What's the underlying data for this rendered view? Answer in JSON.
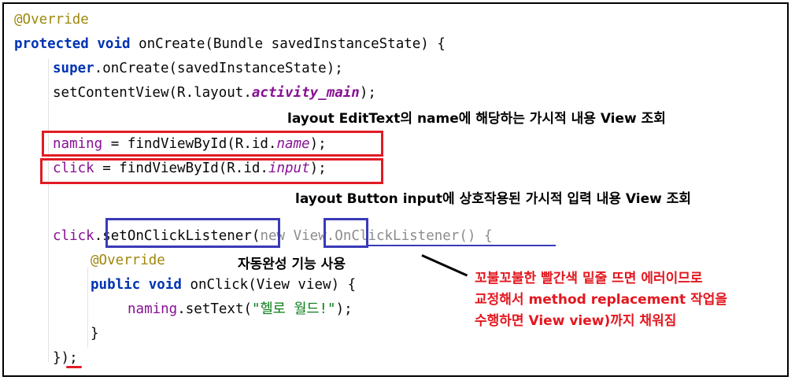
{
  "code": {
    "line1_annotation": "@Override",
    "line2_protected": "protected",
    "line2_void": "void",
    "line2_rest": "onCreate(Bundle savedInstanceState) {",
    "line3_super": "super",
    "line3_rest": ".onCreate(savedInstanceState);",
    "line4_pre": "setContentView(R.layout.",
    "line4_field": "activity_main",
    "line4_post": ");",
    "line5_var": "naming",
    "line5_pre": " = findViewById(R.id.",
    "line5_field": "name",
    "line5_post": ");",
    "line6_var": "click",
    "line6_pre": " = findViewById(R.id.",
    "line6_field": "input",
    "line6_post": ");",
    "line7_var": "click",
    "line7_dot": ".",
    "line7_method": "setOnClickListener",
    "line7_paren": "(",
    "line7_new": "new ",
    "line7_view": "View",
    "line7_dot2": ".",
    "line7_listener": "OnClickListener() {",
    "line8_annotation": "@Override",
    "line9_public": "public",
    "line9_void": "void",
    "line9_rest": "onClick(View view) {",
    "line10_var": "naming",
    "line10_pre": ".setText(",
    "line10_str": "\"헬로 월드!\"",
    "line10_post": ");",
    "line11": "}",
    "line12_pre": "})",
    "line12_semi": ";"
  },
  "annotations": {
    "note_edittext": "layout EditText의 name에 해당하는 가시적 내용 View 조회",
    "note_button": "layout Button input에 상호작용된 가시적 입력 내용 View 조회",
    "note_autocomplete": "자동완성 기능 사용",
    "red_note_line1": "꼬불꼬불한 빨간색 밑줄 뜨면 에러이므로",
    "red_note_line2": "교정해서 method replacement 작업을",
    "red_note_line3": "수행하면 View view)까지 채워짐"
  },
  "colors": {
    "red_box": "#e01b24",
    "blue_box": "#3a3ab8",
    "red_text": "#e3171f",
    "keyword": "#0033b3",
    "annotation": "#9e880d",
    "field": "#871094",
    "string": "#067d17"
  }
}
